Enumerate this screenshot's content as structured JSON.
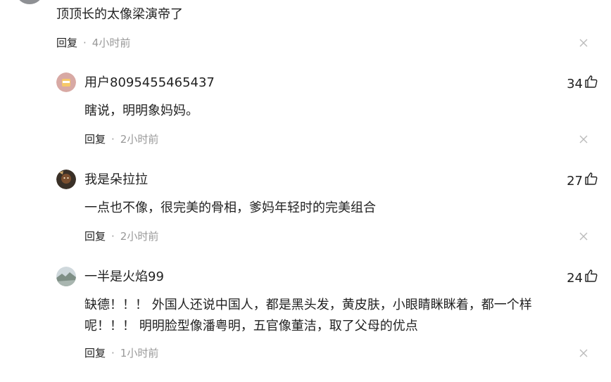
{
  "top_comment": {
    "text": "顶顶长的太像梁演帝了",
    "reply_label": "回复",
    "separator": "·",
    "time": "4小时前"
  },
  "replies": [
    {
      "username": "用户8095455465437",
      "likes": "34",
      "content": "瞎说，明明象妈妈。",
      "reply_label": "回复",
      "separator": "·",
      "time": "2小时前"
    },
    {
      "username": "我是朵拉拉",
      "likes": "27",
      "content": "一点也不像，很完美的骨相，爹妈年轻时的完美组合",
      "reply_label": "回复",
      "separator": "·",
      "time": "2小时前"
    },
    {
      "username": "一半是火焰99",
      "likes": "24",
      "content_line1": "缺德！！！ 外国人还说中国人，都是黑头发，黄皮肤，小眼睛眯眯着，都一个样",
      "content_line2": "呢！！！ 明明脸型像潘粤明，五官像董洁，取了父母的优点",
      "reply_label": "回复",
      "separator": "·",
      "time": "1小时前"
    }
  ],
  "icons": {
    "like": "thumbs-up-icon",
    "close": "close-icon"
  },
  "colors": {
    "text": "#222222",
    "muted": "#999999",
    "close": "#bbbbbb"
  }
}
